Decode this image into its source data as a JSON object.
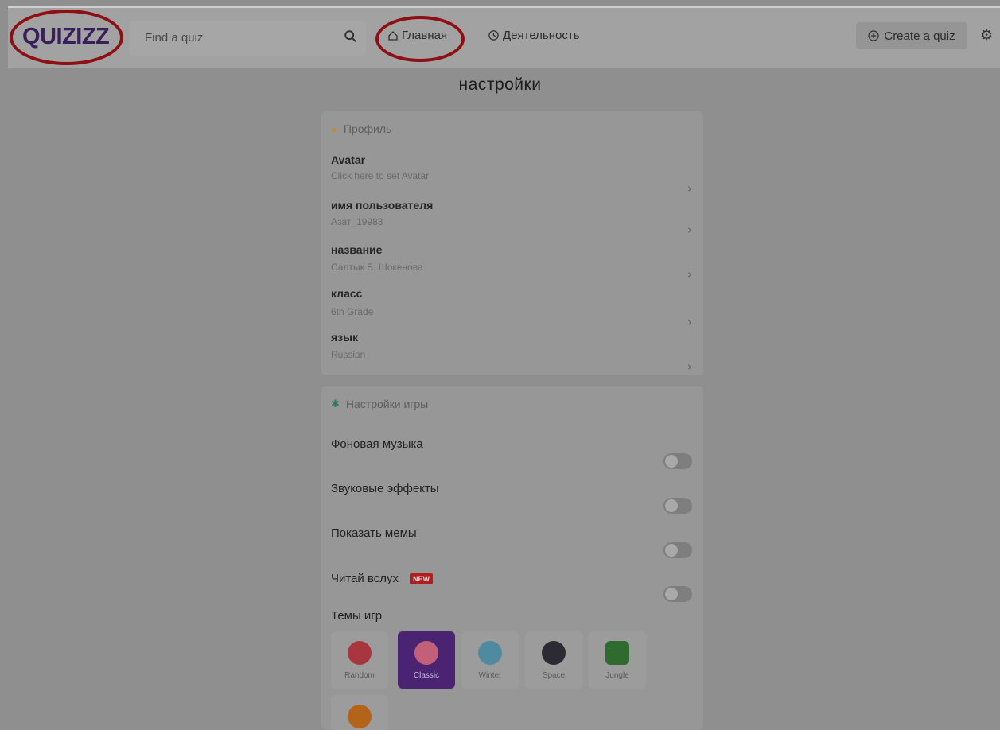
{
  "topbar": {
    "logo": "QUIZIZZ",
    "search_placeholder": "Find a quiz",
    "nav_home": "Главная",
    "nav_activity": "Деятельность",
    "create_label": "Create a quiz"
  },
  "page": {
    "title": "настройки"
  },
  "profile": {
    "header": "Профиль",
    "rows": [
      {
        "label": "Avatar",
        "value": "Click here to set Avatar"
      },
      {
        "label": "имя пользователя",
        "value": "Азат_19983"
      },
      {
        "label": "название",
        "value": "Салтык Б. Шокенова"
      },
      {
        "label": "класс",
        "value": "6th Grade"
      },
      {
        "label": "язык",
        "value": "Russian"
      }
    ]
  },
  "game_settings": {
    "header": "Настройки игры",
    "toggles": [
      {
        "label": "Фоновая музыка",
        "on": false
      },
      {
        "label": "Звуковые эффекты",
        "on": false
      },
      {
        "label": "Показать мемы",
        "on": false
      },
      {
        "label": "Читай вслух",
        "badge": "NEW",
        "on": false
      }
    ],
    "themes_label": "Темы игр",
    "themes": [
      {
        "label": "Random",
        "icon": "monster-icon",
        "color": "#a8363f",
        "selected": false
      },
      {
        "label": "Classic",
        "icon": "balloons-icon",
        "color": "#c2607a",
        "selected": true
      },
      {
        "label": "Winter",
        "icon": "snowglobe-icon",
        "color": "#4f8aa0",
        "selected": false
      },
      {
        "label": "Space",
        "icon": "moon-icon",
        "color": "#2c2a33",
        "selected": false
      },
      {
        "label": "Jungle",
        "icon": "trees-icon",
        "color": "#2f6b2f",
        "selected": false
      },
      {
        "label": "",
        "icon": "pumpkin-icon",
        "color": "#b4631a",
        "selected": false
      }
    ]
  },
  "colors": {
    "accent": "#4a2473",
    "annotation": "#8e0f14",
    "badge": "#b41d1d"
  }
}
